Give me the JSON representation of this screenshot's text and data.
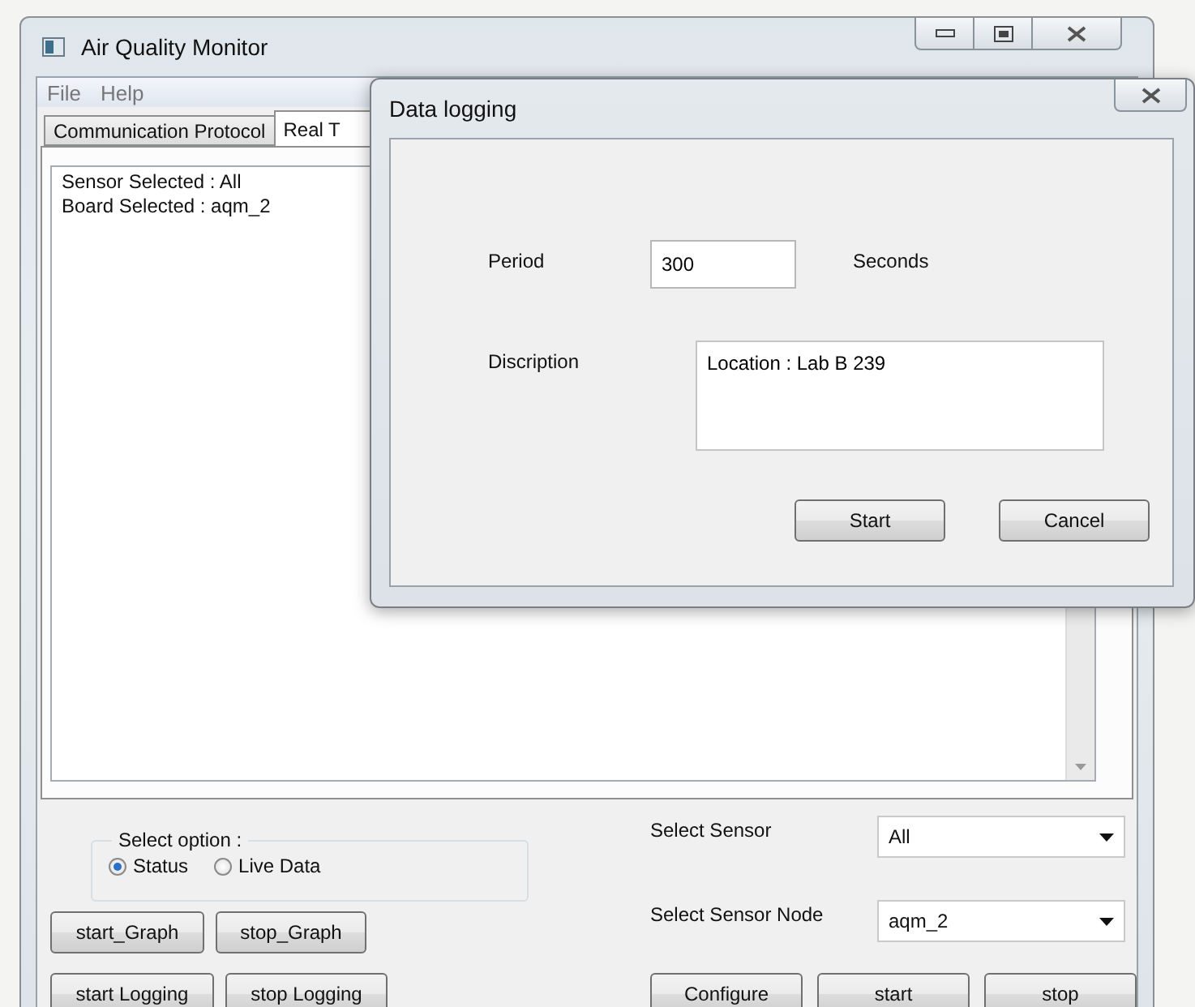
{
  "window": {
    "title": "Air Quality Monitor"
  },
  "menu": [
    {
      "label": "File"
    },
    {
      "label": "Help"
    }
  ],
  "tabs": [
    {
      "label": "Communication Protocol",
      "selected": false
    },
    {
      "label": "Real T",
      "selected": true
    }
  ],
  "log_lines": [
    "Sensor Selected : All",
    "Board Selected : aqm_2"
  ],
  "select_option": {
    "title": "Select option :",
    "options": [
      {
        "label": "Status",
        "selected": true
      },
      {
        "label": "Live Data",
        "selected": false
      }
    ]
  },
  "graph_buttons": [
    "start_Graph",
    "stop_Graph"
  ],
  "logging_buttons": [
    "start Logging",
    "stop Logging"
  ],
  "sensor_fields": [
    {
      "label": "Select Sensor",
      "value": "All"
    },
    {
      "label": "Select Sensor Node",
      "value": "aqm_2"
    }
  ],
  "action_buttons": [
    "Configure",
    "start",
    "stop"
  ],
  "dialog": {
    "title": "Data logging",
    "period": {
      "label": "Period",
      "value": "300",
      "unit": "Seconds"
    },
    "description": {
      "label": "Discription",
      "value": "Location : Lab B 239"
    },
    "buttons": [
      "Start",
      "Cancel"
    ]
  }
}
